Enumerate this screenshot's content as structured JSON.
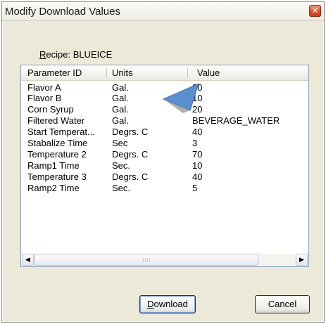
{
  "window": {
    "title": "Modify Download Values",
    "close_label": "✕"
  },
  "recipe": {
    "prefix_accel": "R",
    "prefix_rest": "ecipe: ",
    "name": "BLUEICE"
  },
  "table": {
    "columns": [
      "Parameter ID",
      "Units",
      "Value"
    ],
    "rows": [
      [
        "Flavor A",
        "Gal.",
        "30"
      ],
      [
        "Flavor B",
        "Gal.",
        "10"
      ],
      [
        "Corn Syrup",
        "Gal.",
        "20"
      ],
      [
        "Filtered Water",
        "Gal.",
        "BEVERAGE_WATER"
      ],
      [
        "Start Temperat...",
        "Degrs. C",
        "40"
      ],
      [
        "Stabalize Time",
        "Sec",
        "3"
      ],
      [
        "Temperature 2",
        "Degrs. C",
        "70"
      ],
      [
        "Ramp1 Time",
        "Sec.",
        "10"
      ],
      [
        "Temperature 3",
        "Degrs. C",
        "40"
      ],
      [
        "Ramp2 Time",
        "Sec.",
        "5"
      ]
    ]
  },
  "scrollbar": {
    "left_arrow": "◀",
    "right_arrow": "▶"
  },
  "buttons": {
    "download_accel": "D",
    "download_rest": "ownload",
    "cancel": "Cancel"
  },
  "colors": {
    "title_close": "#d9522f",
    "cursor": "#5b8fcf"
  }
}
